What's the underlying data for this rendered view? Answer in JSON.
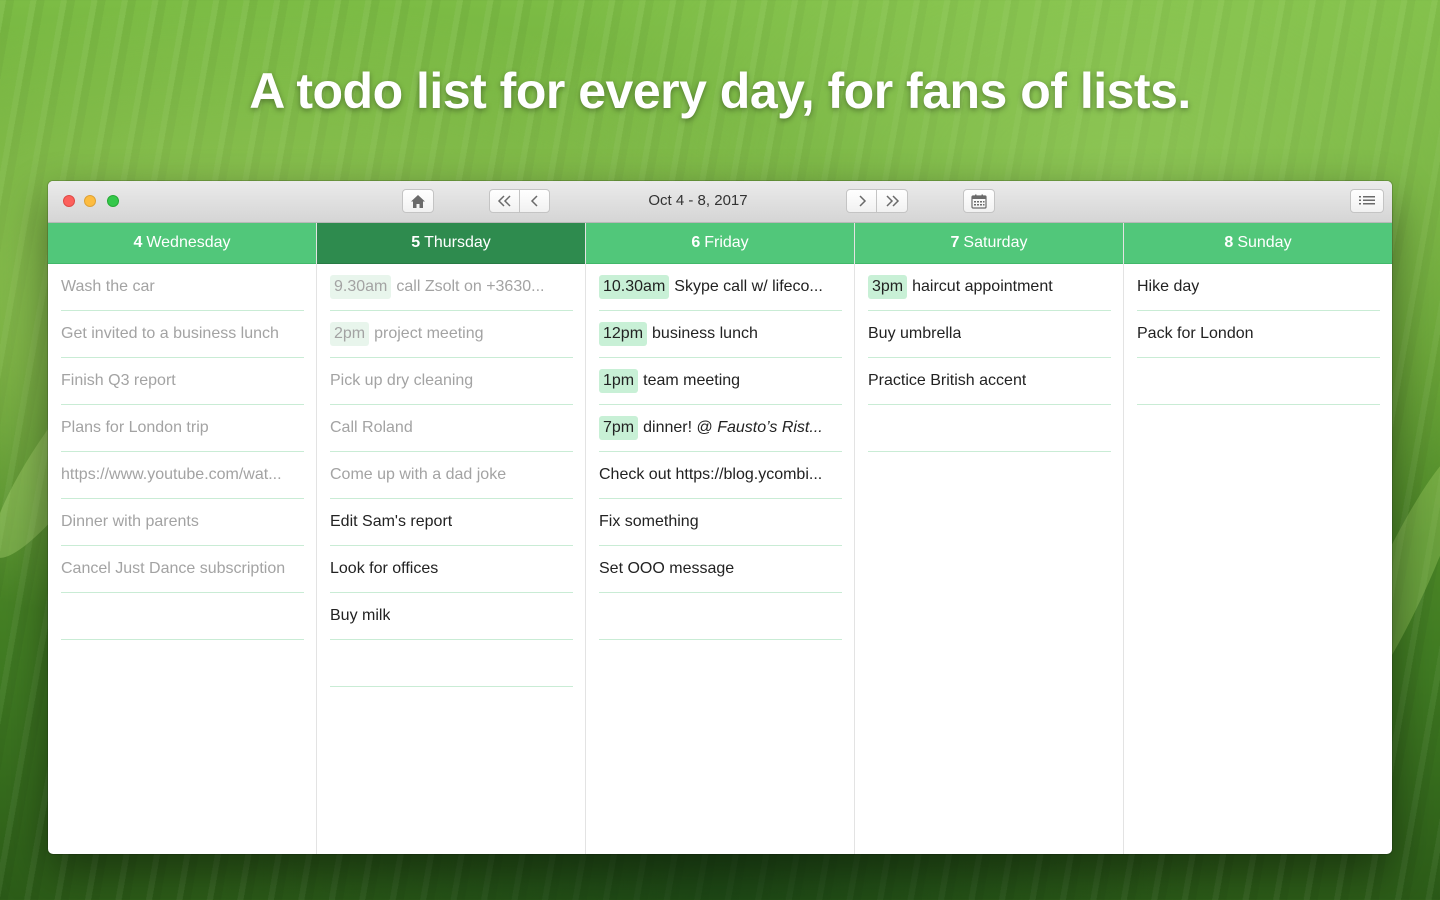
{
  "headline": "A todo list for every day, for fans of lists.",
  "toolbar": {
    "date_range": "Oct 4 - 8, 2017",
    "home_icon": "home-icon",
    "prev_week_icon": "double-chevron-left-icon",
    "prev_day_icon": "chevron-left-icon",
    "next_day_icon": "chevron-right-icon",
    "next_week_icon": "double-chevron-right-icon",
    "calendar_icon": "calendar-icon",
    "list_icon": "list-icon"
  },
  "colors": {
    "day_header": "#51c77a",
    "today_header": "#2e8b4e",
    "time_badge": "#c8f0d6",
    "separator": "#c9ecd5"
  },
  "days": [
    {
      "num": "4",
      "name": "Wednesday",
      "today": false,
      "tasks": [
        {
          "time": "",
          "text": "Wash the car",
          "done": true
        },
        {
          "time": "",
          "text": "Get invited to a business lunch",
          "done": true
        },
        {
          "time": "",
          "text": "Finish Q3 report",
          "done": true
        },
        {
          "time": "",
          "text": "Plans for London trip",
          "done": true
        },
        {
          "time": "",
          "text": "https://www.youtube.com/wat...",
          "done": true
        },
        {
          "time": "",
          "text": "Dinner with parents",
          "done": true
        },
        {
          "time": "",
          "text": "Cancel Just Dance subscription",
          "done": true
        },
        {
          "time": "",
          "text": "",
          "done": false
        }
      ]
    },
    {
      "num": "5",
      "name": "Thursday",
      "today": true,
      "tasks": [
        {
          "time": "9.30am",
          "text": "call Zsolt on +3630...",
          "done": true
        },
        {
          "time": "2pm",
          "text": "project meeting",
          "done": true
        },
        {
          "time": "",
          "text": "Pick up dry cleaning",
          "done": true
        },
        {
          "time": "",
          "text": "Call Roland",
          "done": true
        },
        {
          "time": "",
          "text": "Come up with a dad joke",
          "done": true
        },
        {
          "time": "",
          "text": "Edit Sam's report",
          "done": false
        },
        {
          "time": "",
          "text": "Look for offices",
          "done": false
        },
        {
          "time": "",
          "text": "Buy milk",
          "done": false
        },
        {
          "time": "",
          "text": "",
          "done": false
        }
      ]
    },
    {
      "num": "6",
      "name": "Friday",
      "today": false,
      "tasks": [
        {
          "time": "10.30am",
          "text": "Skype call w/ lifeco...",
          "done": false
        },
        {
          "time": "12pm",
          "text": "business lunch",
          "done": false
        },
        {
          "time": "1pm",
          "text": "team meeting",
          "done": false
        },
        {
          "time": "7pm",
          "text": "dinner! @ ",
          "text_em": "Fausto’s Rist...",
          "done": false
        },
        {
          "time": "",
          "text": "Check out https://blog.ycombi...",
          "done": false
        },
        {
          "time": "",
          "text": "Fix something",
          "done": false
        },
        {
          "time": "",
          "text": "Set OOO message",
          "done": false
        },
        {
          "time": "",
          "text": "",
          "done": false
        }
      ]
    },
    {
      "num": "7",
      "name": "Saturday",
      "today": false,
      "tasks": [
        {
          "time": "3pm",
          "text": "haircut appointment",
          "done": false
        },
        {
          "time": "",
          "text": "Buy umbrella",
          "done": false
        },
        {
          "time": "",
          "text": "Practice British accent",
          "done": false
        },
        {
          "time": "",
          "text": "",
          "done": false
        }
      ]
    },
    {
      "num": "8",
      "name": "Sunday",
      "today": false,
      "tasks": [
        {
          "time": "",
          "text": "Hike day",
          "done": false
        },
        {
          "time": "",
          "text": "Pack for London",
          "done": false
        },
        {
          "time": "",
          "text": "",
          "done": false
        }
      ]
    }
  ]
}
